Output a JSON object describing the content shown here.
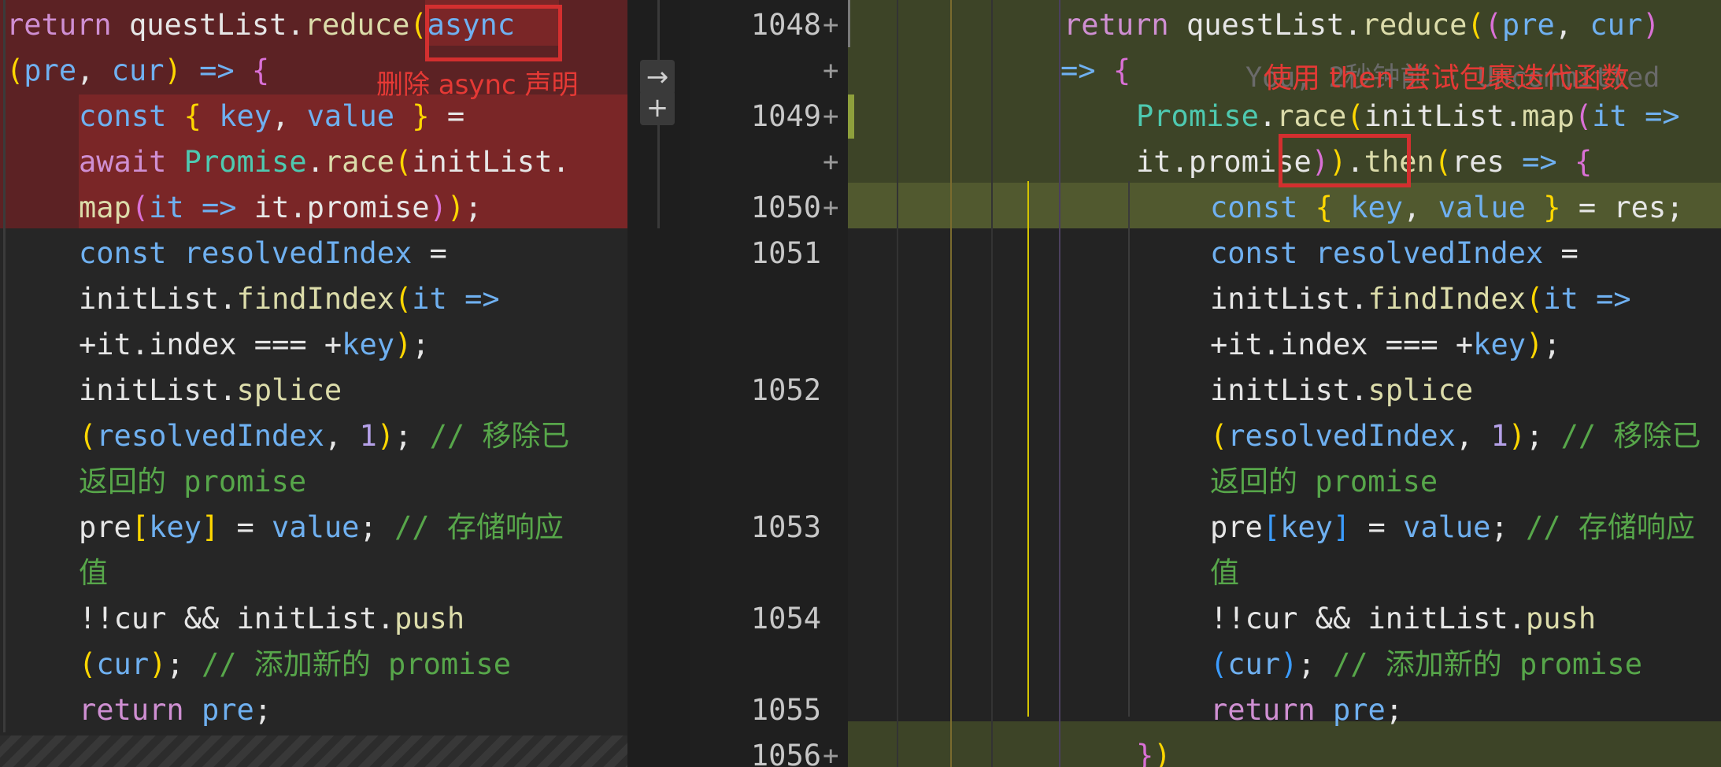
{
  "left_pane": {
    "lines": [
      [
        "return questList.reduce(",
        "async"
      ],
      [
        "(pre, cur) => {"
      ],
      [
        "const { key, value } ="
      ],
      [
        "await Promise.race(initList."
      ],
      [
        "map(it => it.promise));"
      ],
      [
        "const resolvedIndex ="
      ],
      [
        "initList.findIndex(it =>"
      ],
      [
        "+it.index === +key);"
      ],
      [
        "initList.splice"
      ],
      [
        "(resolvedIndex, 1); // 移除已"
      ],
      [
        "返回的 promise"
      ],
      [
        "pre[key] = value; // 存储响应"
      ],
      [
        "值"
      ],
      [
        "!!cur && initList.push"
      ],
      [
        "(cur); // 添加新的 promise"
      ],
      [
        "return pre;"
      ]
    ],
    "annotation": "删除 async 声明"
  },
  "right_pane": {
    "line_numbers": [
      "1048",
      "",
      "1049",
      "",
      "1050",
      "1051",
      "",
      "",
      "1052",
      "",
      "",
      "1053",
      "",
      "1054",
      "",
      "1055",
      "1056"
    ],
    "plus_markers": [
      "+",
      "+",
      "+",
      "+",
      "+",
      "",
      "",
      "",
      "",
      "",
      "",
      "",
      "",
      "",
      "",
      "",
      "+"
    ],
    "annotation": "使用 then 尝试包裹迭代函数",
    "ghost_text": "You, 2秒钟前 · Uncommitted"
  },
  "controls": {
    "arrow_icon": "→",
    "plus_icon": "+"
  }
}
